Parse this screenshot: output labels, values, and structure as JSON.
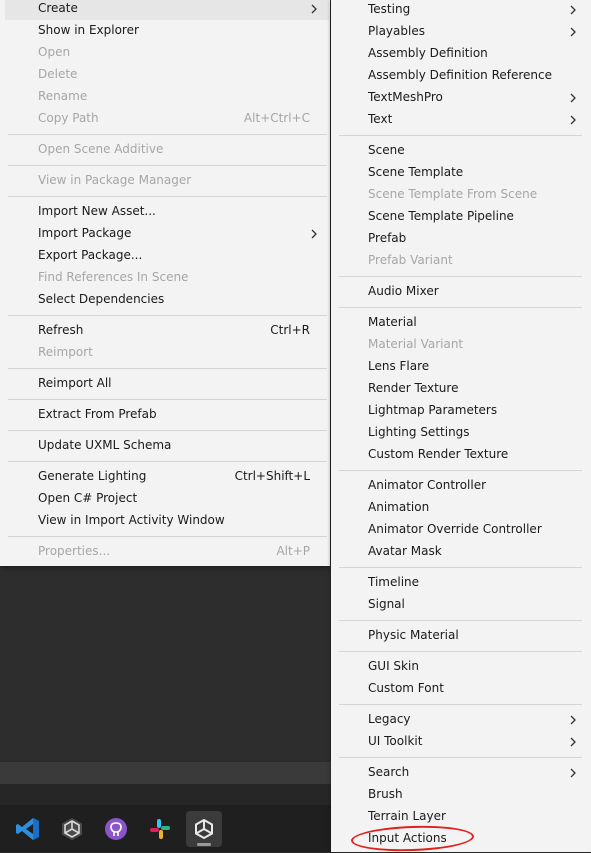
{
  "left_menu": [
    {
      "label": "Create",
      "submenu": true,
      "highlighted": true
    },
    {
      "label": "Show in Explorer"
    },
    {
      "label": "Open",
      "disabled": true
    },
    {
      "label": "Delete",
      "disabled": true
    },
    {
      "label": "Rename",
      "disabled": true
    },
    {
      "label": "Copy Path",
      "disabled": true,
      "shortcut": "Alt+Ctrl+C"
    },
    {
      "separator": true
    },
    {
      "label": "Open Scene Additive",
      "disabled": true
    },
    {
      "separator": true
    },
    {
      "label": "View in Package Manager",
      "disabled": true
    },
    {
      "separator": true
    },
    {
      "label": "Import New Asset..."
    },
    {
      "label": "Import Package",
      "submenu": true
    },
    {
      "label": "Export Package..."
    },
    {
      "label": "Find References In Scene",
      "disabled": true
    },
    {
      "label": "Select Dependencies"
    },
    {
      "separator": true
    },
    {
      "label": "Refresh",
      "shortcut": "Ctrl+R"
    },
    {
      "label": "Reimport",
      "disabled": true
    },
    {
      "separator": true
    },
    {
      "label": "Reimport All"
    },
    {
      "separator": true
    },
    {
      "label": "Extract From Prefab"
    },
    {
      "separator": true
    },
    {
      "label": "Update UXML Schema"
    },
    {
      "separator": true
    },
    {
      "label": "Generate Lighting",
      "shortcut": "Ctrl+Shift+L"
    },
    {
      "label": "Open C# Project"
    },
    {
      "label": "View in Import Activity Window"
    },
    {
      "separator": true
    },
    {
      "label": "Properties...",
      "disabled": true,
      "shortcut": "Alt+P"
    }
  ],
  "right_menu": [
    {
      "label": "Testing",
      "submenu": true
    },
    {
      "label": "Playables",
      "submenu": true
    },
    {
      "label": "Assembly Definition"
    },
    {
      "label": "Assembly Definition Reference"
    },
    {
      "label": "TextMeshPro",
      "submenu": true
    },
    {
      "label": "Text",
      "submenu": true
    },
    {
      "separator": true
    },
    {
      "label": "Scene"
    },
    {
      "label": "Scene Template"
    },
    {
      "label": "Scene Template From Scene",
      "disabled": true
    },
    {
      "label": "Scene Template Pipeline"
    },
    {
      "label": "Prefab"
    },
    {
      "label": "Prefab Variant",
      "disabled": true
    },
    {
      "separator": true
    },
    {
      "label": "Audio Mixer"
    },
    {
      "separator": true
    },
    {
      "label": "Material"
    },
    {
      "label": "Material Variant",
      "disabled": true
    },
    {
      "label": "Lens Flare"
    },
    {
      "label": "Render Texture"
    },
    {
      "label": "Lightmap Parameters"
    },
    {
      "label": "Lighting Settings"
    },
    {
      "label": "Custom Render Texture"
    },
    {
      "separator": true
    },
    {
      "label": "Animator Controller"
    },
    {
      "label": "Animation"
    },
    {
      "label": "Animator Override Controller"
    },
    {
      "label": "Avatar Mask"
    },
    {
      "separator": true
    },
    {
      "label": "Timeline"
    },
    {
      "label": "Signal"
    },
    {
      "separator": true
    },
    {
      "label": "Physic Material"
    },
    {
      "separator": true
    },
    {
      "label": "GUI Skin"
    },
    {
      "label": "Custom Font"
    },
    {
      "separator": true
    },
    {
      "label": "Legacy",
      "submenu": true
    },
    {
      "label": "UI Toolkit",
      "submenu": true
    },
    {
      "separator": true
    },
    {
      "label": "Search",
      "submenu": true
    },
    {
      "label": "Brush"
    },
    {
      "label": "Terrain Layer"
    },
    {
      "label": "Input Actions",
      "annotated": true
    }
  ],
  "taskbar": [
    {
      "icon": "vscode-icon"
    },
    {
      "icon": "unity-hub-icon"
    },
    {
      "icon": "github-desktop-icon"
    },
    {
      "icon": "slack-icon"
    },
    {
      "icon": "unity-editor-icon",
      "active": true
    }
  ],
  "colors": {
    "menu_bg": "#f3f3f3",
    "disabled_text": "#a6a6a6",
    "highlight": "#e6e6e6",
    "annotation": "#e0211d"
  }
}
